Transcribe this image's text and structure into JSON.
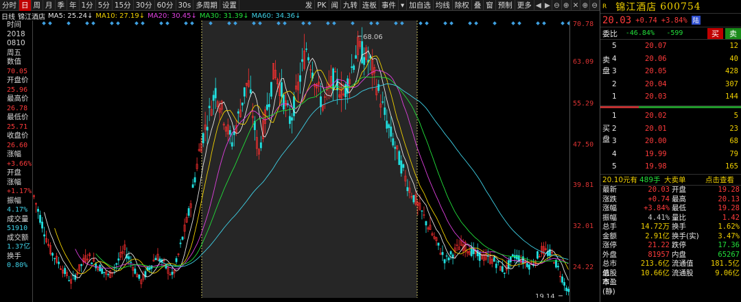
{
  "toolbar": {
    "items": [
      "分时",
      "日",
      "周",
      "月",
      "季",
      "年",
      "1分",
      "5分",
      "15分",
      "30分",
      "60分",
      "30s",
      "多周期",
      "设置"
    ],
    "active": "日",
    "right": [
      "发",
      "PK",
      "闻",
      "九转",
      "连板",
      "事件",
      "▾",
      "加自选",
      "均线",
      "除权",
      "叠",
      "窗",
      "预制",
      "更多"
    ]
  },
  "ma": {
    "period": "日线",
    "name": "锦江酒店",
    "items": [
      {
        "label": "MA5: 25.24↓",
        "color": "#e8e8e8"
      },
      {
        "label": "MA10: 27.19↓",
        "color": "#f0d000"
      },
      {
        "label": "MA20: 30.45↓",
        "color": "#e040e0"
      },
      {
        "label": "MA30: 31.39↓",
        "color": "#22e03a"
      },
      {
        "label": "MA60: 34.36↓",
        "color": "#3fd2e8"
      }
    ]
  },
  "left": [
    {
      "l": "时间",
      "v": ""
    },
    {
      "l": "2018",
      "v": ""
    },
    {
      "l": "0810",
      "v": ""
    },
    {
      "l": "周五",
      "v": ""
    },
    {
      "l": "数值",
      "v": ""
    },
    {
      "l": "",
      "v": "70.05",
      "c": "red"
    },
    {
      "l": "开盘价",
      "v": ""
    },
    {
      "l": "",
      "v": "25.96",
      "c": "red"
    },
    {
      "l": "最高价",
      "v": ""
    },
    {
      "l": "",
      "v": "26.78",
      "c": "red"
    },
    {
      "l": "最低价",
      "v": ""
    },
    {
      "l": "",
      "v": "25.71",
      "c": "red"
    },
    {
      "l": "收盘价",
      "v": ""
    },
    {
      "l": "",
      "v": "26.60",
      "c": "red"
    },
    {
      "l": "涨幅",
      "v": ""
    },
    {
      "l": "",
      "v": "+3.66%",
      "c": "red"
    },
    {
      "l": "开盘",
      "v": ""
    },
    {
      "l": "涨幅",
      "v": ""
    },
    {
      "l": "",
      "v": "+1.17%",
      "c": "red"
    },
    {
      "l": "振幅",
      "v": ""
    },
    {
      "l": "",
      "v": "4.17%",
      "c": "cyan"
    },
    {
      "l": "成交量",
      "v": ""
    },
    {
      "l": "",
      "v": "51910",
      "c": "cyan"
    },
    {
      "l": "成交额",
      "v": ""
    },
    {
      "l": "",
      "v": "1.37亿",
      "c": "cyan"
    },
    {
      "l": "换手",
      "v": ""
    },
    {
      "l": "",
      "v": "0.80%",
      "c": "cyan"
    }
  ],
  "yaxis": [
    "70.78",
    "63.09",
    "55.29",
    "47.50",
    "39.81",
    "32.01",
    "24.22"
  ],
  "chart_data": {
    "type": "candlestick",
    "high_label": "68.06",
    "low_label": "19.14",
    "ylim": [
      19,
      71
    ]
  },
  "right": {
    "marker": "R",
    "name": "锦江酒店",
    "code": "600754",
    "price": "20.03",
    "change": "+0.74",
    "pct": "+3.84%",
    "board": "陆",
    "wb_label": "委比",
    "wb": "-46.84%",
    "wc": "-599",
    "buy_btn": "买",
    "sell_btn": "卖",
    "sell_side": "卖盘",
    "buy_side": "买盘",
    "asks": [
      {
        "n": "5",
        "p": "20.07",
        "v": "12"
      },
      {
        "n": "4",
        "p": "20.06",
        "v": "40"
      },
      {
        "n": "3",
        "p": "20.05",
        "v": "428"
      },
      {
        "n": "2",
        "p": "20.04",
        "v": "307"
      },
      {
        "n": "1",
        "p": "20.03",
        "v": "144"
      }
    ],
    "bids": [
      {
        "n": "1",
        "p": "20.02",
        "v": "5"
      },
      {
        "n": "2",
        "p": "20.01",
        "v": "23"
      },
      {
        "n": "3",
        "p": "20.00",
        "v": "68"
      },
      {
        "n": "4",
        "p": "19.99",
        "v": "79"
      },
      {
        "n": "5",
        "p": "19.98",
        "v": "165"
      }
    ],
    "bigorder": {
      "a": "20.10元有",
      "b": "489手",
      "c": "大卖单",
      "d": "点击查看"
    },
    "stats": [
      [
        "最新",
        "20.03",
        "开盘",
        "19.28"
      ],
      [
        "涨跌",
        "+0.74",
        "最高",
        "20.13"
      ],
      [
        "涨幅",
        "+3.84%",
        "最低",
        "19.28"
      ],
      [
        "振幅",
        "4.41%",
        "量比",
        "1.42"
      ],
      [
        "总手",
        "14.72万",
        "换手",
        "1.62%"
      ],
      [
        "金额",
        "2.91亿",
        "换手(实)",
        "3.47%"
      ],
      [
        "涨停",
        "21.22",
        "跌停",
        "17.36"
      ],
      [
        "外盘",
        "81957",
        "内盘",
        "65267"
      ],
      [
        "总市值",
        "213.6亿",
        "流通值",
        "181.5亿"
      ],
      [
        "总股本",
        "10.66亿",
        "流通股",
        "9.06亿"
      ],
      [
        "市盈(静)",
        "",
        "",
        ""
      ]
    ]
  }
}
